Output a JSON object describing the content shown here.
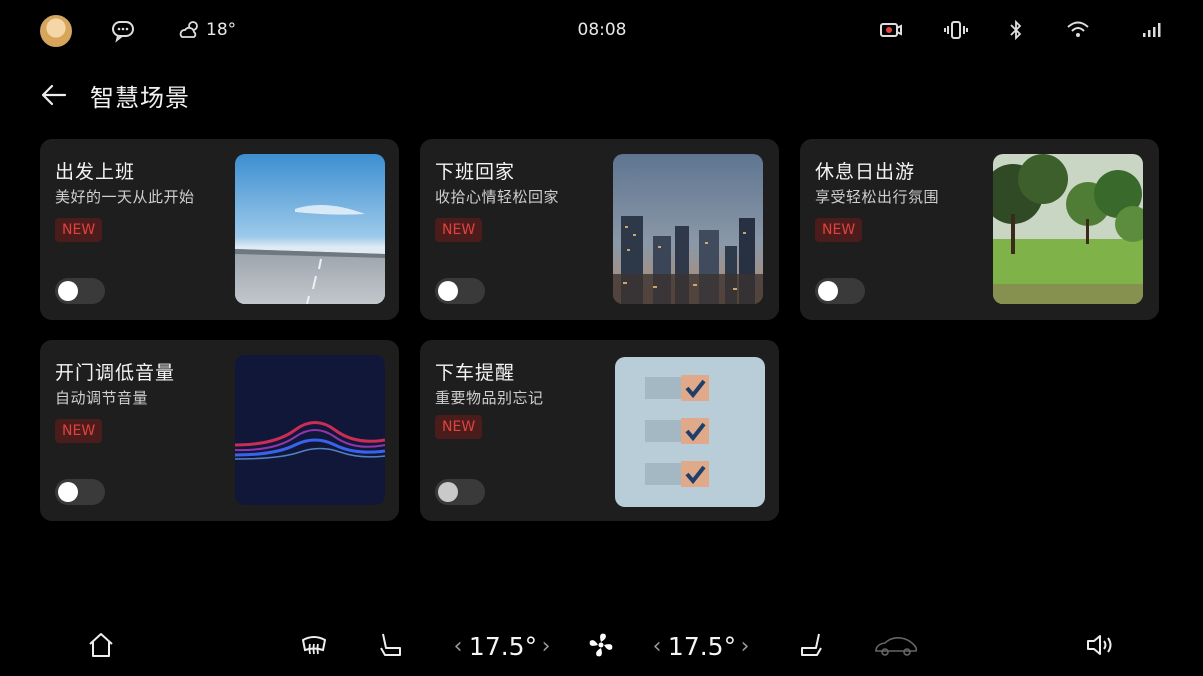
{
  "status": {
    "time": "08:08",
    "weather_temp": "18°",
    "icons": [
      "avatar",
      "chat-icon",
      "weather-icon",
      "screen-record-icon",
      "vibrate-icon",
      "bluetooth-icon",
      "wifi-icon",
      "signal-icon"
    ]
  },
  "header": {
    "title": "智慧场景"
  },
  "cards": [
    {
      "title": "出发上班",
      "subtitle": "美好的一天从此开始",
      "badge": "NEW",
      "enabled": false,
      "image": "highway-sky"
    },
    {
      "title": "下班回家",
      "subtitle": "收拾心情轻松回家",
      "badge": "NEW",
      "enabled": false,
      "image": "city-skyline"
    },
    {
      "title": "休息日出游",
      "subtitle": "享受轻松出行氛围",
      "badge": "NEW",
      "enabled": false,
      "image": "park-trees"
    },
    {
      "title": "开门调低音量",
      "subtitle": "自动调节音量",
      "badge": "NEW",
      "enabled": false,
      "image": "sound-wave"
    },
    {
      "title": "下车提醒",
      "subtitle": "重要物品别忘记",
      "badge": "NEW",
      "enabled": false,
      "image": "checklist"
    }
  ],
  "bottombar": {
    "left_temp": "17.5°",
    "right_temp": "17.5°",
    "icons": [
      "home-icon",
      "rear-defrost-icon",
      "seat-left-icon",
      "fan-icon",
      "seat-right-icon",
      "car-icon",
      "volume-icon"
    ]
  }
}
